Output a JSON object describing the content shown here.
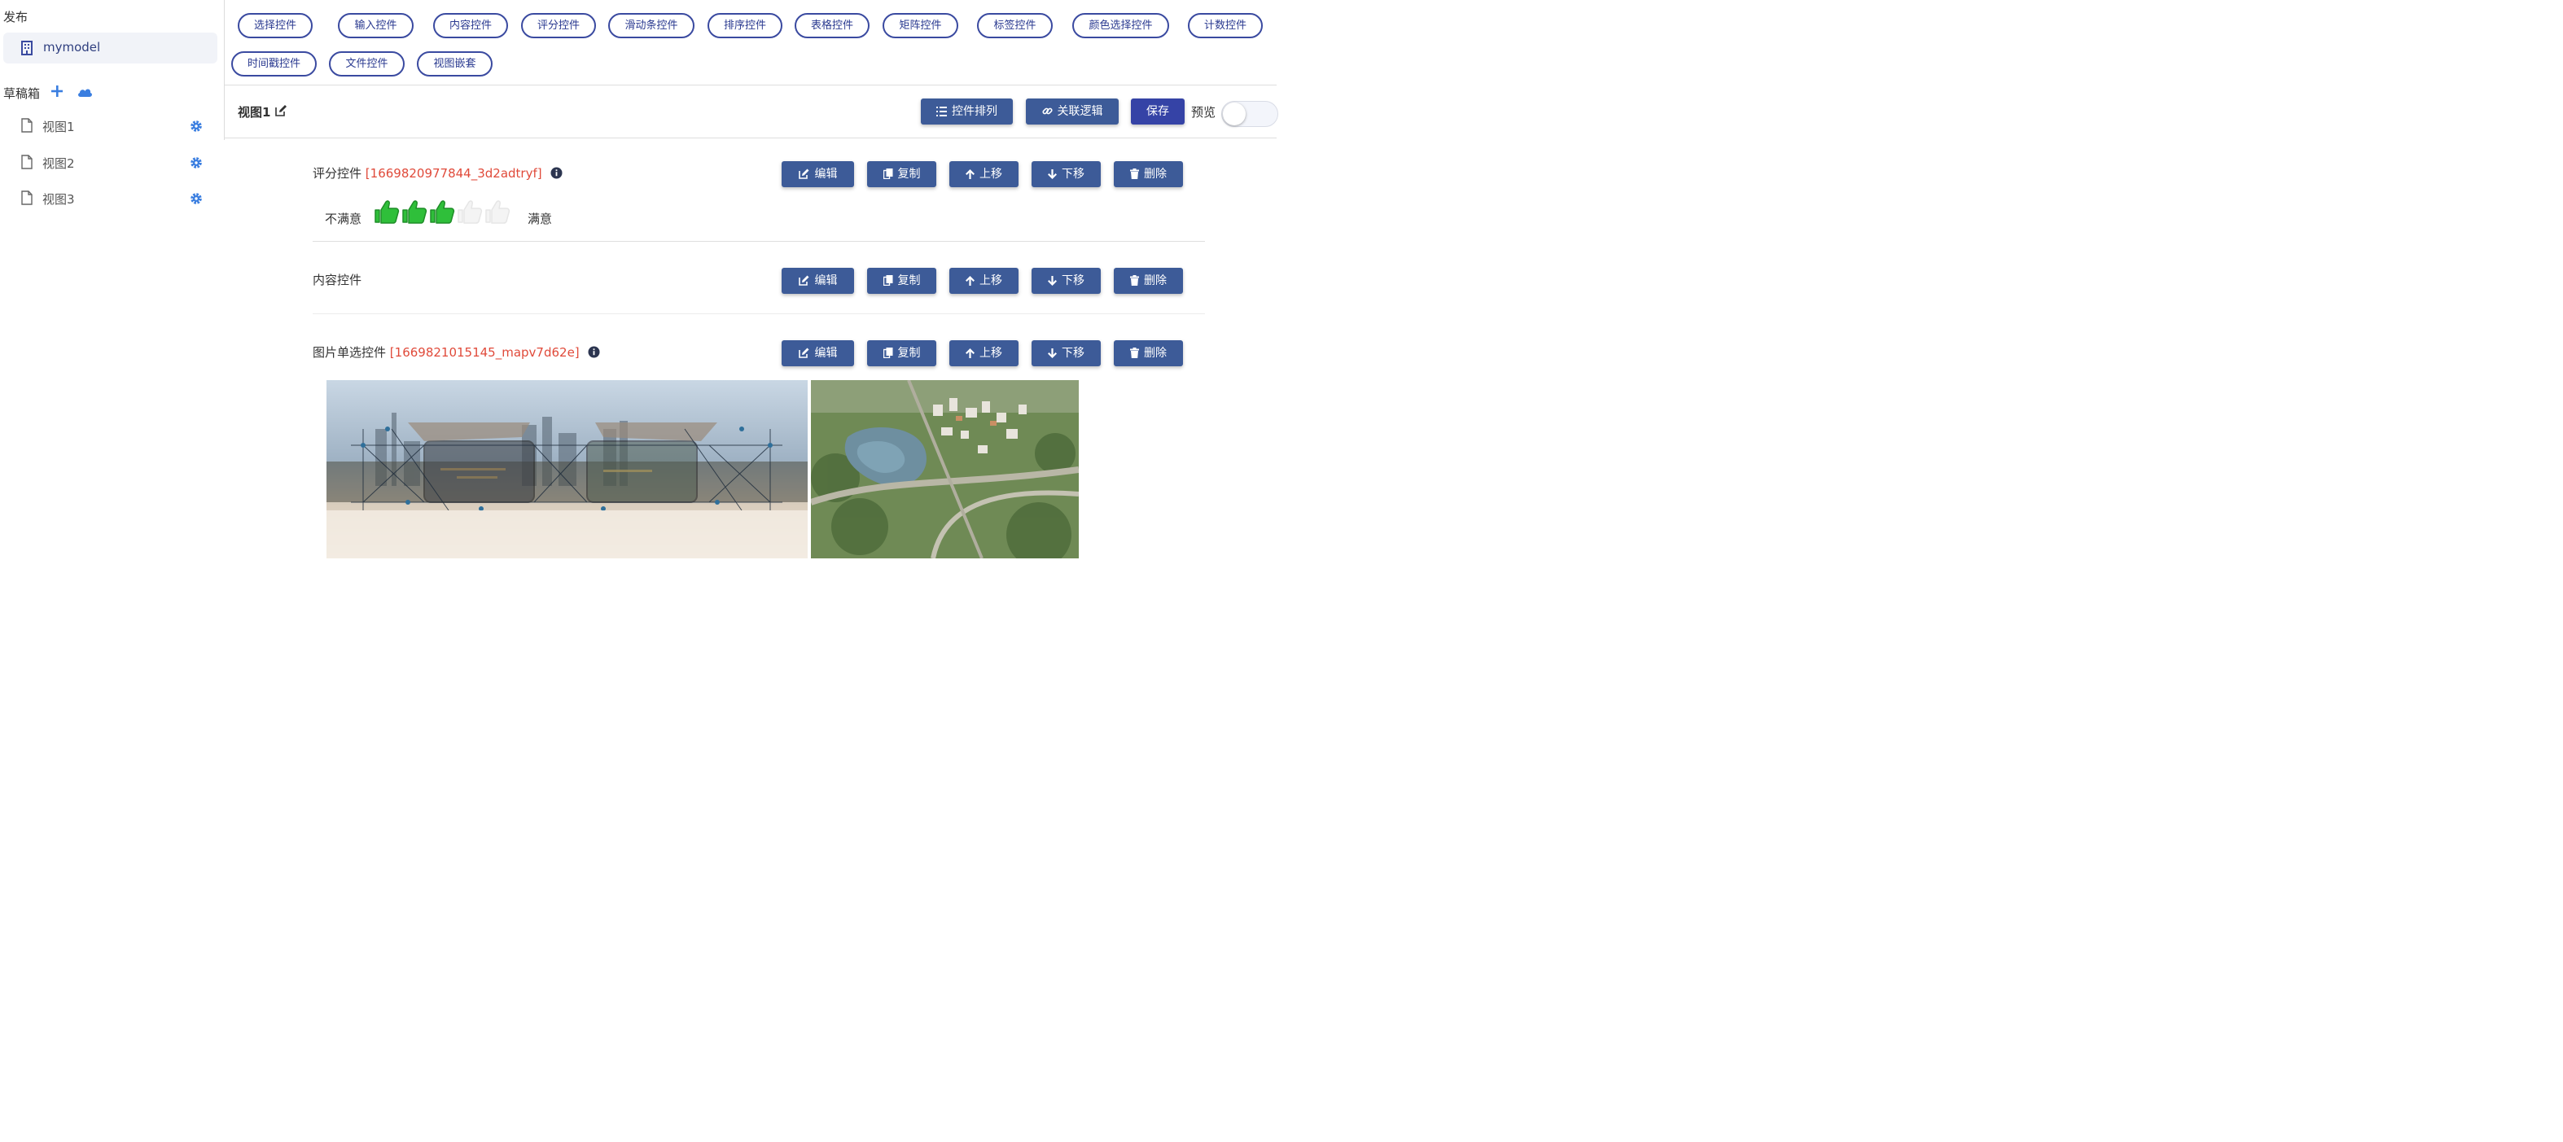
{
  "sidebar": {
    "publish_title": "发布",
    "model_name": "mymodel",
    "draft_title": "草稿箱",
    "views": [
      {
        "label": "视图1"
      },
      {
        "label": "视图2"
      },
      {
        "label": "视图3"
      }
    ]
  },
  "palette": {
    "chips": [
      "选择控件",
      "输入控件",
      "内容控件",
      "评分控件",
      "滑动条控件",
      "排序控件",
      "表格控件",
      "矩阵控件",
      "标签控件",
      "颜色选择控件",
      "计数控件",
      "时间戳控件",
      "文件控件",
      "视图嵌套"
    ]
  },
  "toolbar": {
    "view_title": "视图1",
    "arrange_label": "控件排列",
    "logic_label": "关联逻辑",
    "save_label": "保存",
    "preview_label": "预览",
    "preview_on": false
  },
  "actions": {
    "edit": "编辑",
    "copy": "复制",
    "up": "上移",
    "down": "下移",
    "delete": "删除"
  },
  "controls": {
    "rating": {
      "title": "评分控件",
      "id": "[1669820977844_3d2adtryf]",
      "left_label": "不满意",
      "right_label": "满意",
      "value": 3,
      "max": 5,
      "active_color": "#2fbf3a"
    },
    "content": {
      "title": "内容控件"
    },
    "image_choice": {
      "title": "图片单选控件",
      "id": "[1669821015145_mapv7d62e]",
      "images": [
        "city-phones-image",
        "aerial-park-image"
      ]
    }
  },
  "colors": {
    "accent": "#3543a6",
    "action_button": "#3d5b98",
    "chip_border": "#3a4aa0",
    "id_red": "#e04a3a"
  }
}
